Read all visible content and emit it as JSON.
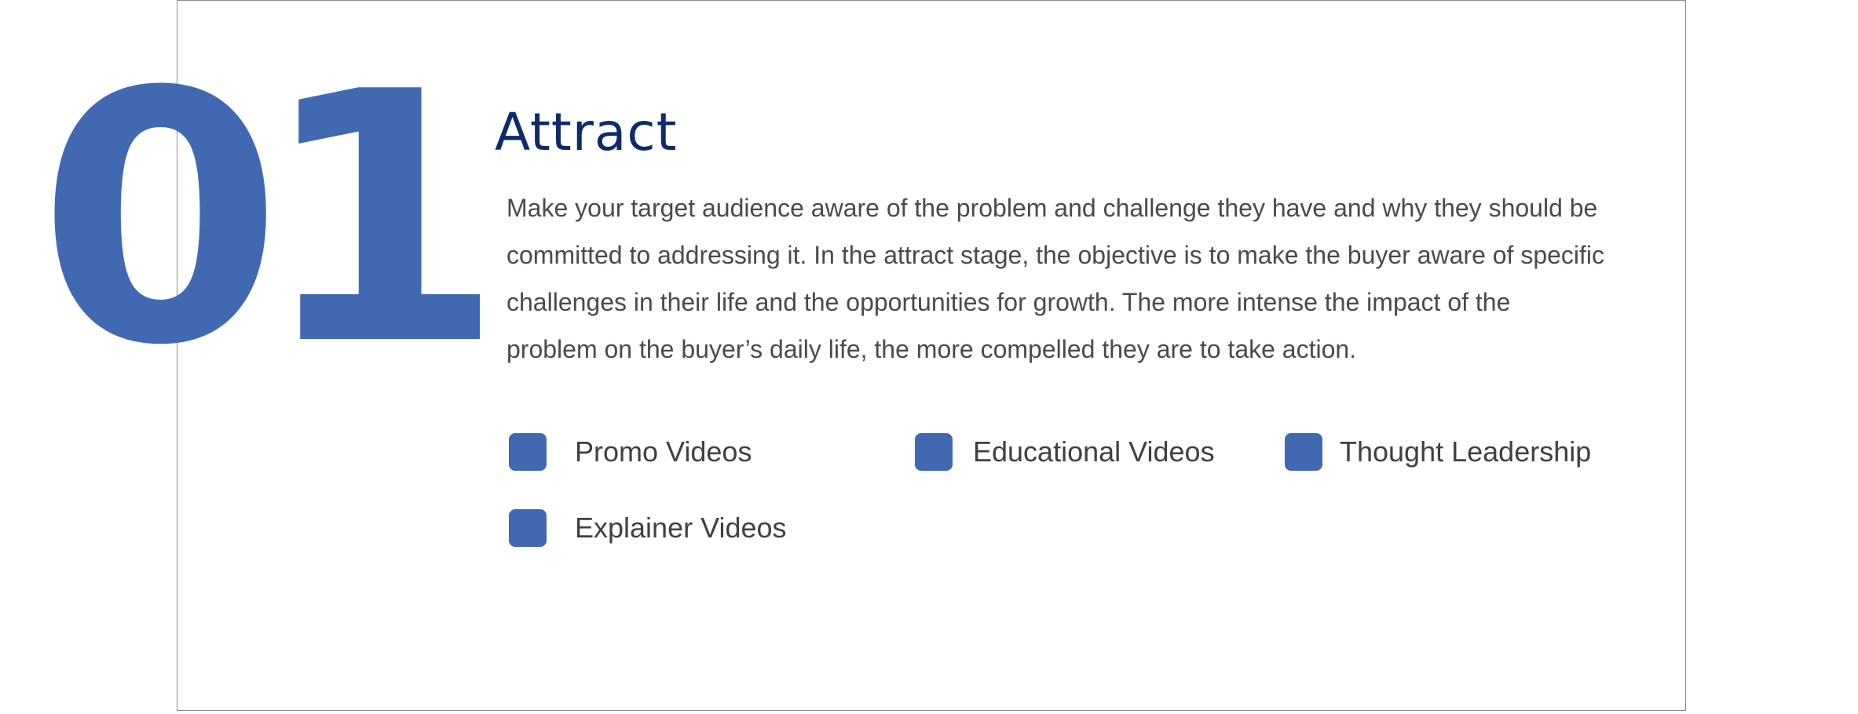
{
  "step": {
    "number": "01",
    "color": "#4169b2"
  },
  "title": "Attract",
  "description": "Make your target audience aware of the problem and challenge they have and why they should be committed to addressing it. In the attract stage, the objective is to make the buyer aware of specific challenges in their life and the opportunities for growth. The more intense the impact of the problem on the buyer’s daily life, the more compelled they are to take action.",
  "tags": [
    {
      "label": "Promo Videos",
      "icon": "square-bullet-icon"
    },
    {
      "label": "Educational Videos",
      "icon": "square-bullet-icon"
    },
    {
      "label": "Thought Leadership",
      "icon": "square-bullet-icon"
    },
    {
      "label": "Explainer Videos",
      "icon": "square-bullet-icon"
    }
  ],
  "colors": {
    "accent": "#4169b2",
    "title": "#0d2b6b",
    "body_text": "#4a4a4a",
    "border": "#8a8a8a"
  }
}
